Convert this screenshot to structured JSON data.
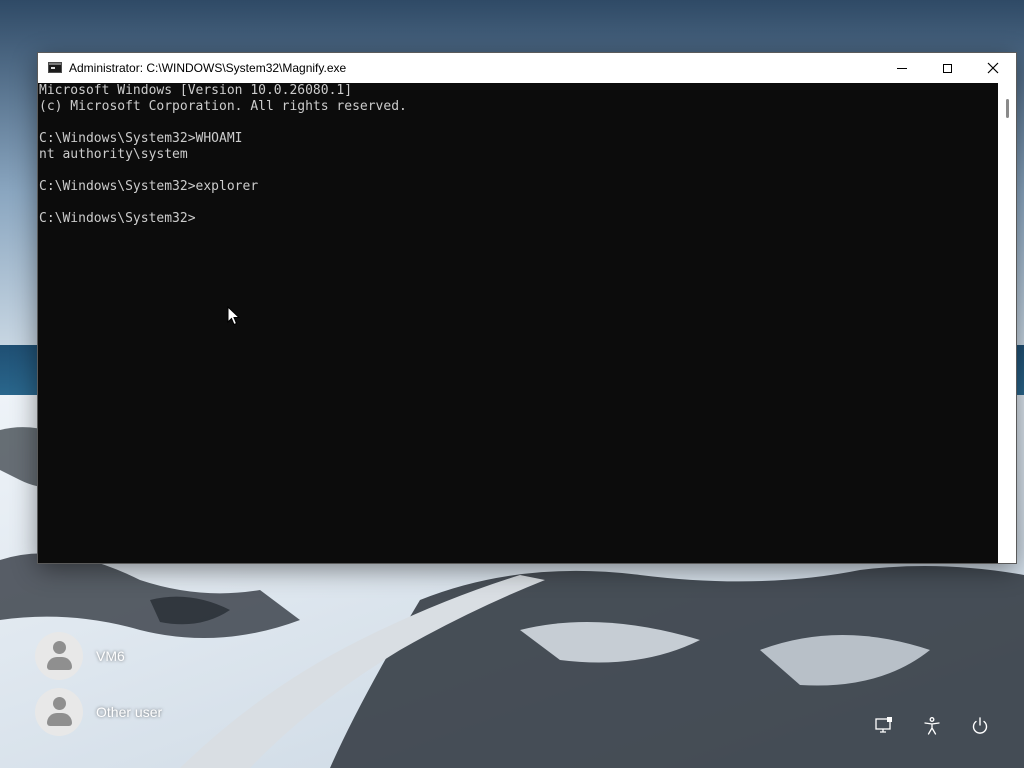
{
  "window": {
    "title": "Administrator: C:\\WINDOWS\\System32\\Magnify.exe",
    "minimize_icon": "minimize-icon",
    "maximize_icon": "maximize-icon",
    "close_icon": "close-icon"
  },
  "console": {
    "lines": [
      "Microsoft Windows [Version 10.0.26080.1]",
      "(c) Microsoft Corporation. All rights reserved.",
      "",
      "C:\\Windows\\System32>WHOAMI",
      "nt authority\\system",
      "",
      "C:\\Windows\\System32>explorer",
      "",
      "C:\\Windows\\System32>"
    ],
    "background_color": "#0c0c0c",
    "text_color": "#cccccc"
  },
  "users": [
    {
      "name": "VM6",
      "icon": "user-avatar-icon"
    },
    {
      "name": "Other user",
      "icon": "user-avatar-icon"
    }
  ],
  "tray": {
    "icons": [
      "network-icon",
      "accessibility-icon",
      "power-icon"
    ]
  }
}
